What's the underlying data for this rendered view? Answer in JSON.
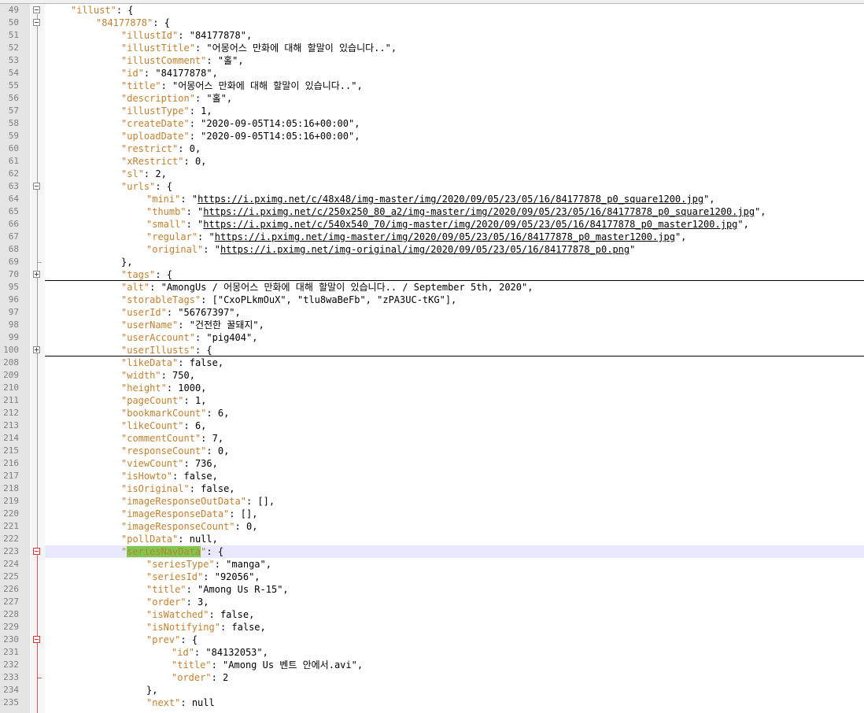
{
  "editor": {
    "lines": [
      {
        "num": "49",
        "key": "illust",
        "suffix": ": {"
      },
      {
        "num": "50",
        "key": "84177878",
        "suffix": ": {"
      },
      {
        "num": "51",
        "key": "illustId",
        "suffix": ": \"84177878\","
      },
      {
        "num": "52",
        "key": "illustTitle",
        "suffix": ": \"어몽어스 만화에 대해 할말이 있습니다..\","
      },
      {
        "num": "53",
        "key": "illustComment",
        "suffix": ": \"홀\","
      },
      {
        "num": "54",
        "key": "id",
        "suffix": ": \"84177878\","
      },
      {
        "num": "55",
        "key": "title",
        "suffix": ": \"어몽어스 만화에 대해 할말이 있습니다..\","
      },
      {
        "num": "56",
        "key": "description",
        "suffix": ": \"홀\","
      },
      {
        "num": "57",
        "key": "illustType",
        "suffix": ": 1,"
      },
      {
        "num": "58",
        "key": "createDate",
        "suffix": ": \"2020-09-05T14:05:16+00:00\","
      },
      {
        "num": "59",
        "key": "uploadDate",
        "suffix": ": \"2020-09-05T14:05:16+00:00\","
      },
      {
        "num": "60",
        "key": "restrict",
        "suffix": ": 0,"
      },
      {
        "num": "61",
        "key": "xRestrict",
        "suffix": ": 0,"
      },
      {
        "num": "62",
        "key": "sl",
        "suffix": ": 2,"
      },
      {
        "num": "63",
        "key": "urls",
        "suffix": ": {"
      },
      {
        "num": "64",
        "key": "mini",
        "suffix": ": \"",
        "url": "https://i.pximg.net/c/48x48/img-master/img/2020/09/05/23/05/16/84177878_p0_square1200.jpg",
        "tail": "\","
      },
      {
        "num": "65",
        "key": "thumb",
        "suffix": ": \"",
        "url": "https://i.pximg.net/c/250x250_80_a2/img-master/img/2020/09/05/23/05/16/84177878_p0_square1200.jpg",
        "tail": "\","
      },
      {
        "num": "66",
        "key": "small",
        "suffix": ": \"",
        "url": "https://i.pximg.net/c/540x540_70/img-master/img/2020/09/05/23/05/16/84177878_p0_master1200.jpg",
        "tail": "\","
      },
      {
        "num": "67",
        "key": "regular",
        "suffix": ": \"",
        "url": "https://i.pximg.net/img-master/img/2020/09/05/23/05/16/84177878_p0_master1200.jpg",
        "tail": "\","
      },
      {
        "num": "68",
        "key": "original",
        "suffix": ": \"",
        "url": "https://i.pximg.net/img-original/img/2020/09/05/23/05/16/84177878_p0.png",
        "tail": "\""
      },
      {
        "num": "69",
        "key": "",
        "suffix": "},"
      },
      {
        "num": "70",
        "key": "tags",
        "suffix": ": {"
      },
      {
        "num": "95",
        "key": "alt",
        "suffix": ": \"AmongUs / 어몽어스 만화에 대해 할말이 있습니다.. / September 5th, 2020\","
      },
      {
        "num": "96",
        "key": "storableTags",
        "suffix": ": [\"CxoPLkmOuX\", \"tlu8waBeFb\", \"zPA3UC-tKG\"],"
      },
      {
        "num": "97",
        "key": "userId",
        "suffix": ": \"56767397\","
      },
      {
        "num": "98",
        "key": "userName",
        "suffix": ": \"건전한 꿀돼지\","
      },
      {
        "num": "99",
        "key": "userAccount",
        "suffix": ": \"pig404\","
      },
      {
        "num": "100",
        "key": "userIllusts",
        "suffix": ": {"
      },
      {
        "num": "208",
        "key": "likeData",
        "suffix": ": false,"
      },
      {
        "num": "209",
        "key": "width",
        "suffix": ": 750,"
      },
      {
        "num": "210",
        "key": "height",
        "suffix": ": 1000,"
      },
      {
        "num": "211",
        "key": "pageCount",
        "suffix": ": 1,"
      },
      {
        "num": "212",
        "key": "bookmarkCount",
        "suffix": ": 6,"
      },
      {
        "num": "213",
        "key": "likeCount",
        "suffix": ": 6,"
      },
      {
        "num": "214",
        "key": "commentCount",
        "suffix": ": 7,"
      },
      {
        "num": "215",
        "key": "responseCount",
        "suffix": ": 0,"
      },
      {
        "num": "216",
        "key": "viewCount",
        "suffix": ": 736,"
      },
      {
        "num": "217",
        "key": "isHowto",
        "suffix": ": false,"
      },
      {
        "num": "218",
        "key": "isOriginal",
        "suffix": ": false,"
      },
      {
        "num": "219",
        "key": "imageResponseOutData",
        "suffix": ": [],"
      },
      {
        "num": "220",
        "key": "imageResponseData",
        "suffix": ": [],"
      },
      {
        "num": "221",
        "key": "imageResponseCount",
        "suffix": ": 0,"
      },
      {
        "num": "222",
        "key": "pollData",
        "suffix": ": null,"
      },
      {
        "num": "223",
        "key": "seriesNavData",
        "suffix": ": {"
      },
      {
        "num": "224",
        "key": "seriesType",
        "suffix": ": \"manga\","
      },
      {
        "num": "225",
        "key": "seriesId",
        "suffix": ": \"92056\","
      },
      {
        "num": "226",
        "key": "title",
        "suffix": ": \"Among Us R-15\","
      },
      {
        "num": "227",
        "key": "order",
        "suffix": ": 3,"
      },
      {
        "num": "228",
        "key": "isWatched",
        "suffix": ": false,"
      },
      {
        "num": "229",
        "key": "isNotifying",
        "suffix": ": false,"
      },
      {
        "num": "230",
        "key": "prev",
        "suffix": ": {"
      },
      {
        "num": "231",
        "key": "id",
        "suffix": ": \"84132053\","
      },
      {
        "num": "232",
        "key": "title",
        "suffix": ": \"Among Us 벤트 안에서.avi\","
      },
      {
        "num": "233",
        "key": "order",
        "suffix": ": 2"
      },
      {
        "num": "234",
        "key": "",
        "suffix": "},"
      },
      {
        "num": "235",
        "key": "next",
        "suffix": ": null"
      }
    ]
  }
}
